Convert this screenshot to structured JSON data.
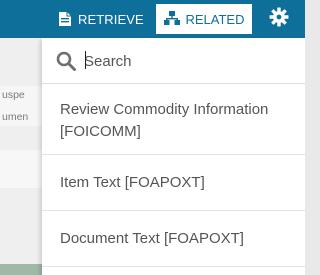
{
  "toolbar": {
    "retrieve_label": "RETRIEVE",
    "related_label": "RELATED",
    "bg_color": "#0e6f9a"
  },
  "background_page": {
    "line1": "uspe",
    "line2": "umen"
  },
  "menu": {
    "search": {
      "placeholder": "Search",
      "value": ""
    },
    "items": [
      {
        "line1": "Review Commodity Information",
        "line2": "[FOICOMM]"
      },
      {
        "line1": "Item Text [FOAPOXT]"
      },
      {
        "line1": "Document Text [FOAPOXT]"
      }
    ]
  },
  "icons": {
    "retrieve": "retrieve-document-icon",
    "related": "related-hierarchy-icon",
    "settings": "gear-icon",
    "search": "search-icon"
  }
}
